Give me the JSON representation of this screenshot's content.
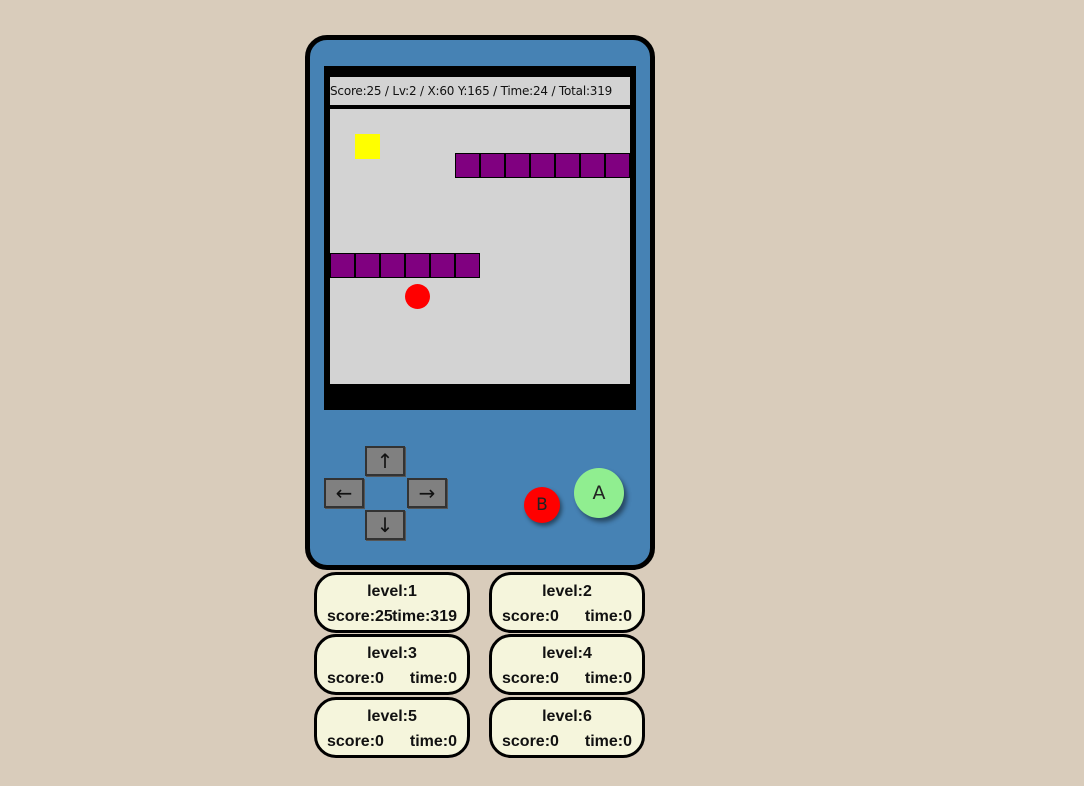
{
  "hud": {
    "text": "Score:25 / Lv:2 / X:60 Y:165 / Time:24 / Total:319"
  },
  "colors": {
    "background": "#d9ccbb",
    "device": "#4682b4",
    "screen_bg": "#d3d3d3",
    "brick": "#800080",
    "player": "#ffff00",
    "ball": "#ff0000",
    "button_a": "#90ee90",
    "button_b": "#ff0000",
    "card_bg": "#f5f5dc"
  },
  "controls": {
    "up": "↑",
    "down": "↓",
    "left": "←",
    "right": "→",
    "a": "A",
    "b": "B"
  },
  "levels": [
    {
      "level": "level:1",
      "score": "score:25",
      "time": "time:319"
    },
    {
      "level": "level:2",
      "score": "score:0",
      "time": "time:0"
    },
    {
      "level": "level:3",
      "score": "score:0",
      "time": "time:0"
    },
    {
      "level": "level:4",
      "score": "score:0",
      "time": "time:0"
    },
    {
      "level": "level:5",
      "score": "score:0",
      "time": "time:0"
    },
    {
      "level": "level:6",
      "score": "score:0",
      "time": "time:0"
    }
  ]
}
